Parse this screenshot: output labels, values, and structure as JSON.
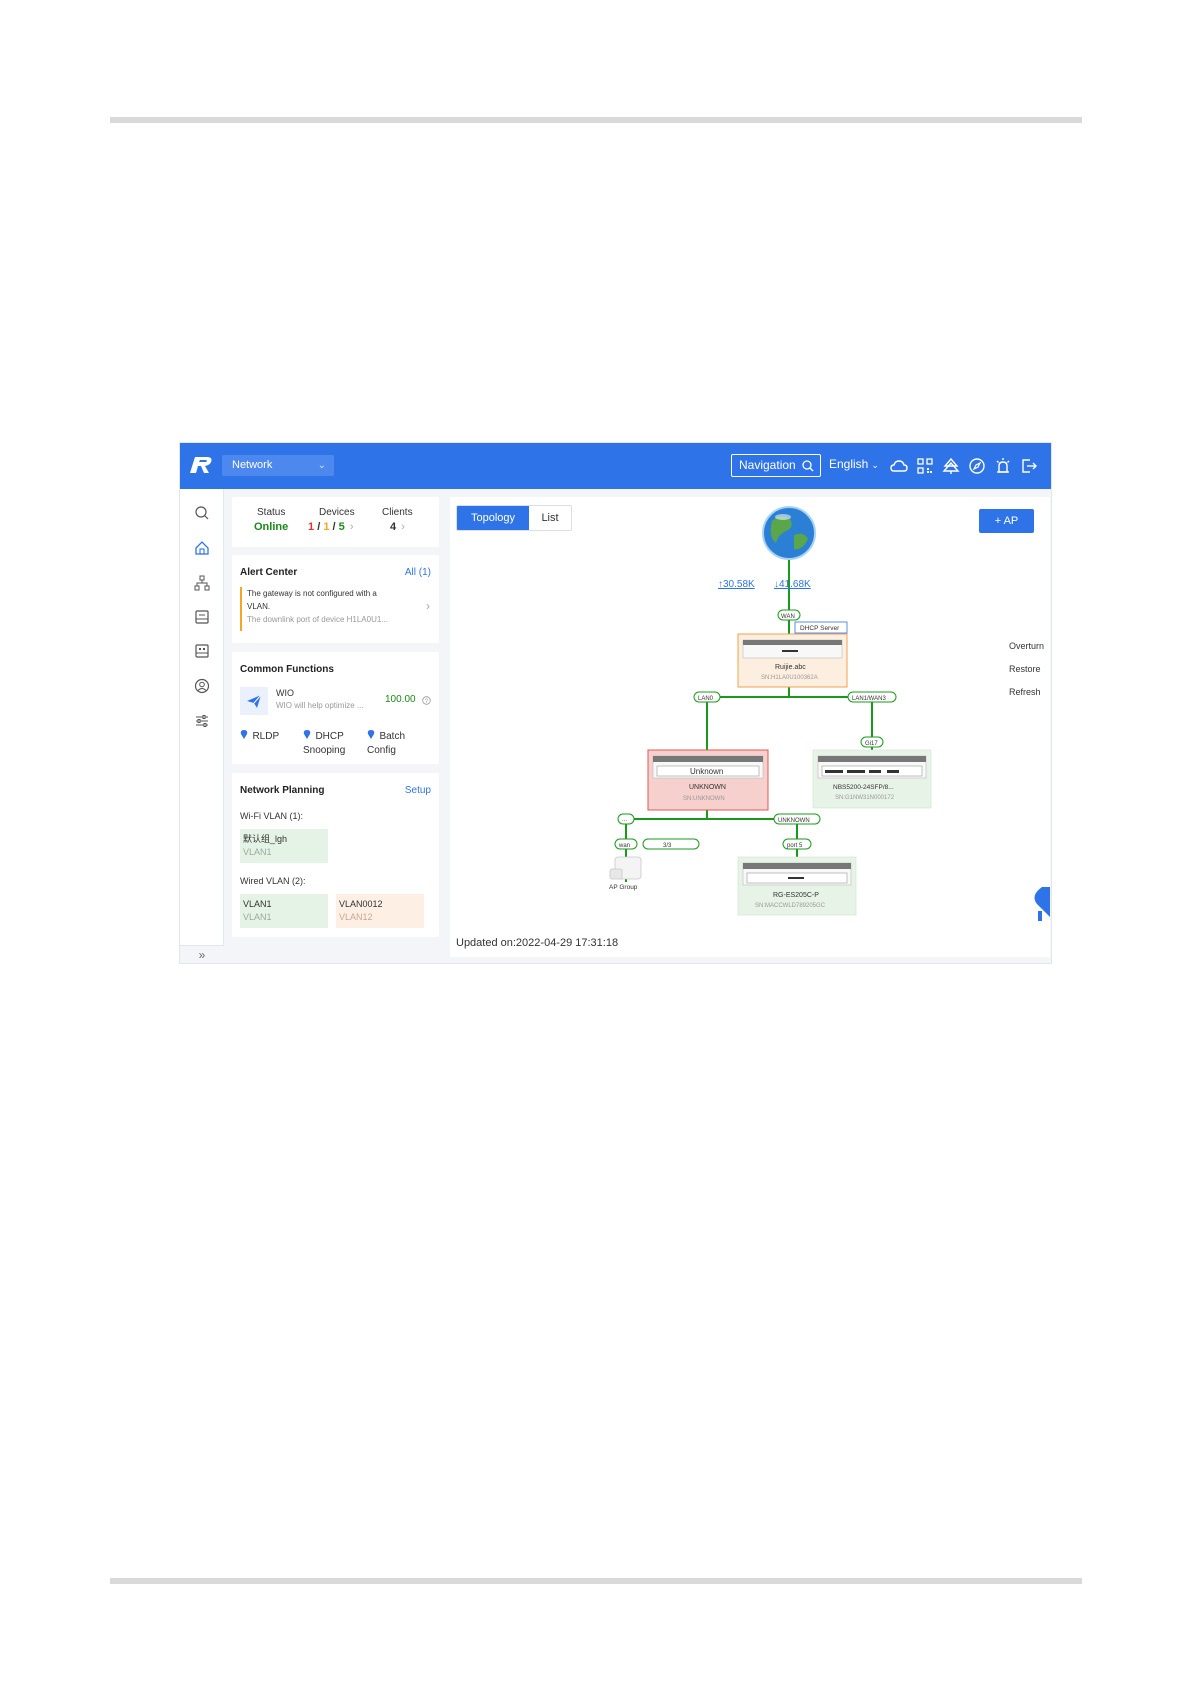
{
  "topbar": {
    "network_select": "Network",
    "navigation_label": "Navigation",
    "language": "English"
  },
  "status_card": {
    "status_label": "Status",
    "status_value": "Online",
    "devices_label": "Devices",
    "devices_a": "1",
    "devices_b": "1",
    "devices_c": "5",
    "sep": "/",
    "clients_label": "Clients",
    "clients_value": "4"
  },
  "alert_center": {
    "title": "Alert Center",
    "all_link": "All (1)",
    "line1": "The gateway is not configured with a",
    "line2": "VLAN.",
    "line3": "The downlink port of device H1LA0U1..."
  },
  "common_functions": {
    "title": "Common Functions",
    "wio_name": "WIO",
    "wio_desc": "WIO will help optimize ...",
    "wio_score": "100.00",
    "f1": "RLDP",
    "f2a": "DHCP",
    "f2b": "Snooping",
    "f3a": "Batch",
    "f3b": "Config"
  },
  "network_planning": {
    "title": "Network Planning",
    "setup": "Setup",
    "wifi_vlan": "Wi-Fi VLAN (1):",
    "wifi_item_name": "默认组_lgh",
    "wifi_item_vlan": "VLAN1",
    "wired_vlan": "Wired VLAN (2):",
    "wired1_name": "VLAN1",
    "wired1_vlan": "VLAN1",
    "wired2_name": "VLAN0012",
    "wired2_vlan": "VLAN12"
  },
  "main": {
    "tab_topology": "Topology",
    "tab_list": "List",
    "add_ap": "+ AP",
    "overturn": "Overturn",
    "restore": "Restore",
    "refresh": "Refresh",
    "updated": "Updated on:2022-04-29 17:31:18"
  },
  "topology": {
    "up_rate": "↑30.58K",
    "down_rate": "↓41.68K",
    "wan_port": "WAN",
    "dhcp_badge": "DHCP Server",
    "gateway_name": "Ruijie.abc",
    "gateway_sn": "SN:H1LA0U100362A",
    "lan0_port": "LAN0",
    "lan1_port": "LAN1/WAN3",
    "unknown_title": "Unknown",
    "unknown_name": "UNKNOWN",
    "unknown_sn": "SN:UNKNOWN",
    "gi_port": "Gi17",
    "nbs_name": "NBS5200-24SFP/8...",
    "nbs_sn": "SN:G1NW31N000172",
    "dots_port": "...",
    "unknown_port": "UNKNOWN",
    "wan_small": "wan",
    "count": "3/3",
    "port5": "port 5",
    "ap_group": "AP Group",
    "es_name": "RG-ES205C-P",
    "es_sn": "SN:MACCWLD789205GC"
  },
  "colors": {
    "brand_blue": "#2f73e8",
    "online_green": "#1a8a1a",
    "alert_orange": "#f5a623",
    "link_green": "#1a9a1a",
    "unknown_red": "#f6d0cc"
  }
}
